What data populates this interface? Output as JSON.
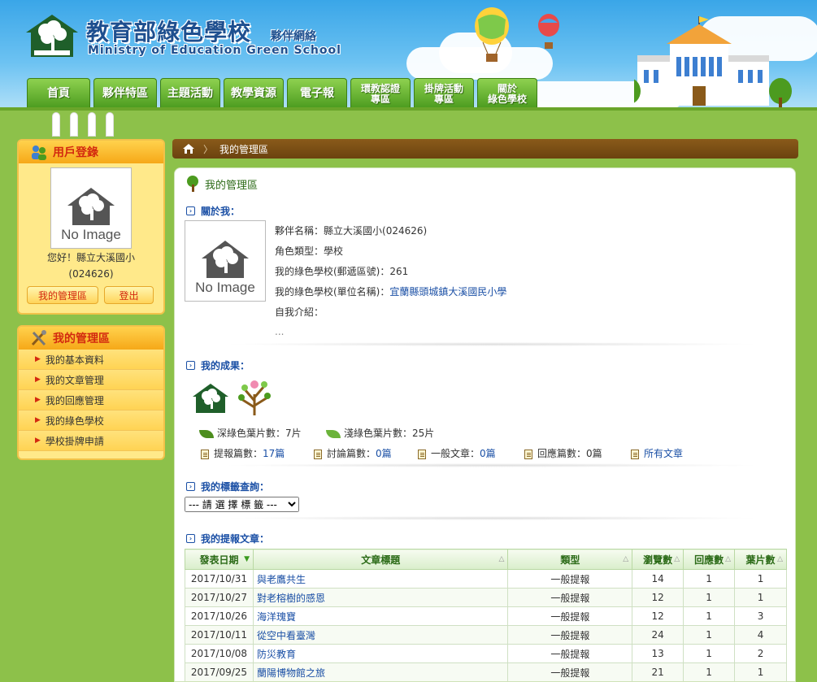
{
  "header": {
    "title_zh": "教育部綠色學校",
    "subtitle_zh": "夥伴網絡",
    "title_en": "Ministry of Education Green School",
    "emblem_label": "綠色學校"
  },
  "nav": [
    {
      "label": "首頁",
      "small": false,
      "width": 78
    },
    {
      "label": "夥伴特區",
      "small": false,
      "width": 78
    },
    {
      "label": "主題活動",
      "small": false,
      "width": 74
    },
    {
      "label": "教學資源",
      "small": false,
      "width": 74
    },
    {
      "label": "電子報",
      "small": false,
      "width": 74
    },
    {
      "label": "環教認證\n專區",
      "small": true,
      "width": 74
    },
    {
      "label": "掛牌活動\n專區",
      "small": true,
      "width": 74
    },
    {
      "label": "關於\n綠色學校",
      "small": true,
      "width": 74
    }
  ],
  "login": {
    "title": "用戶登錄",
    "no_image": "No Image",
    "greeting_line1": "您好！縣立大溪國小",
    "greeting_line2": "(024626)",
    "manage_button": "我的管理區",
    "logout_button": "登出"
  },
  "manage_menu": {
    "title": "我的管理區",
    "items": [
      "我的基本資料",
      "我的文章管理",
      "我的回應管理",
      "我的綠色學校",
      "學校掛牌申請"
    ]
  },
  "breadcrumb": {
    "current": "我的管理區"
  },
  "panel": {
    "title": "我的管理區",
    "about": {
      "heading": "關於我：",
      "no_image": "No Image",
      "partner_label": "夥伴名稱：",
      "partner_value": "縣立大溪國小(024626)",
      "role_label": "角色類型：",
      "role_value": "學校",
      "zip_label": "我的綠色學校(郵遞區號)：",
      "zip_value": "261",
      "unit_label": "我的綠色學校(單位名稱)：",
      "unit_value": "宜蘭縣頭城鎮大溪國民小學",
      "intro_label": "自我介紹：",
      "intro_value": "..."
    },
    "achievements": {
      "heading": "我的成果：",
      "dark_leaves_label": "深綠色葉片數：",
      "dark_leaves_value": "7片",
      "light_leaves_label": "淺綠色葉片數：",
      "light_leaves_value": "25片",
      "stats": [
        {
          "label": "提報篇數：",
          "value": "17篇",
          "link": true
        },
        {
          "label": "討論篇數：",
          "value": "0篇",
          "link": true
        },
        {
          "label": "一般文章：",
          "value": "0篇",
          "link": true
        },
        {
          "label": "回應篇數：",
          "value": "0篇",
          "link": false
        },
        {
          "label": "",
          "value": "所有文章",
          "link": true
        }
      ]
    },
    "tags": {
      "heading": "我的標籤查詢：",
      "select_value": "--- 請 選 擇 標 籤 ---"
    },
    "articles": {
      "heading": "我的提報文章：",
      "columns": [
        "發表日期",
        "文章標題",
        "類型",
        "瀏覽數",
        "回應數",
        "葉片數"
      ],
      "rows": [
        {
          "date": "2017/10/31",
          "title": "與老鷹共生",
          "type": "一般提報",
          "views": "14",
          "replies": "1",
          "leaves": "1"
        },
        {
          "date": "2017/10/27",
          "title": "對老榕樹的感恩",
          "type": "一般提報",
          "views": "12",
          "replies": "1",
          "leaves": "1"
        },
        {
          "date": "2017/10/26",
          "title": "海洋瑰寶",
          "type": "一般提報",
          "views": "12",
          "replies": "1",
          "leaves": "3"
        },
        {
          "date": "2017/10/11",
          "title": "從空中看臺灣",
          "type": "一般提報",
          "views": "24",
          "replies": "1",
          "leaves": "4"
        },
        {
          "date": "2017/10/08",
          "title": "防災教育",
          "type": "一般提報",
          "views": "13",
          "replies": "1",
          "leaves": "2"
        },
        {
          "date": "2017/09/25",
          "title": "蘭陽博物館之旅",
          "type": "一般提報",
          "views": "21",
          "replies": "1",
          "leaves": "1"
        }
      ]
    }
  }
}
